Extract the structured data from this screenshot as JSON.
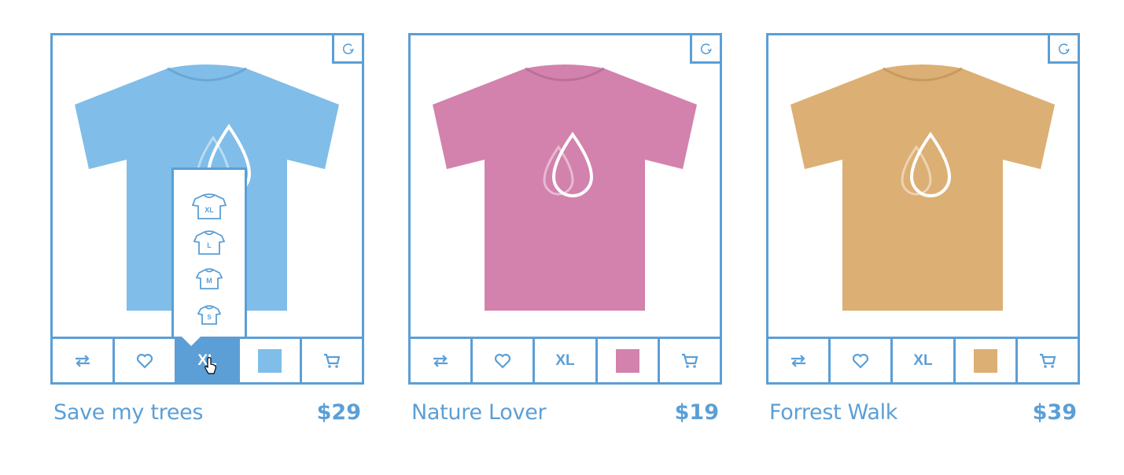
{
  "products": [
    {
      "name": "Save my trees",
      "price": "$29",
      "shirt_color": "#80bde8",
      "size_label": "XL",
      "swatch_color": "#80bde8",
      "size_menu_open": true,
      "size_options": [
        "XL",
        "L",
        "M",
        "S"
      ],
      "icons": [
        "rotate-icon",
        "compare-icon",
        "heart-icon",
        "cart-icon"
      ]
    },
    {
      "name": "Nature Lover",
      "price": "$19",
      "shirt_color": "#d282ad",
      "size_label": "XL",
      "swatch_color": "#d282ad",
      "size_menu_open": false,
      "icons": [
        "rotate-icon",
        "compare-icon",
        "heart-icon",
        "cart-icon"
      ]
    },
    {
      "name": "Forrest Walk",
      "price": "$39",
      "shirt_color": "#dcaf74",
      "size_label": "XL",
      "swatch_color": "#dcaf74",
      "size_menu_open": false,
      "icons": [
        "rotate-icon",
        "compare-icon",
        "heart-icon",
        "cart-icon"
      ]
    }
  ],
  "accent_color": "#5b9fd6"
}
